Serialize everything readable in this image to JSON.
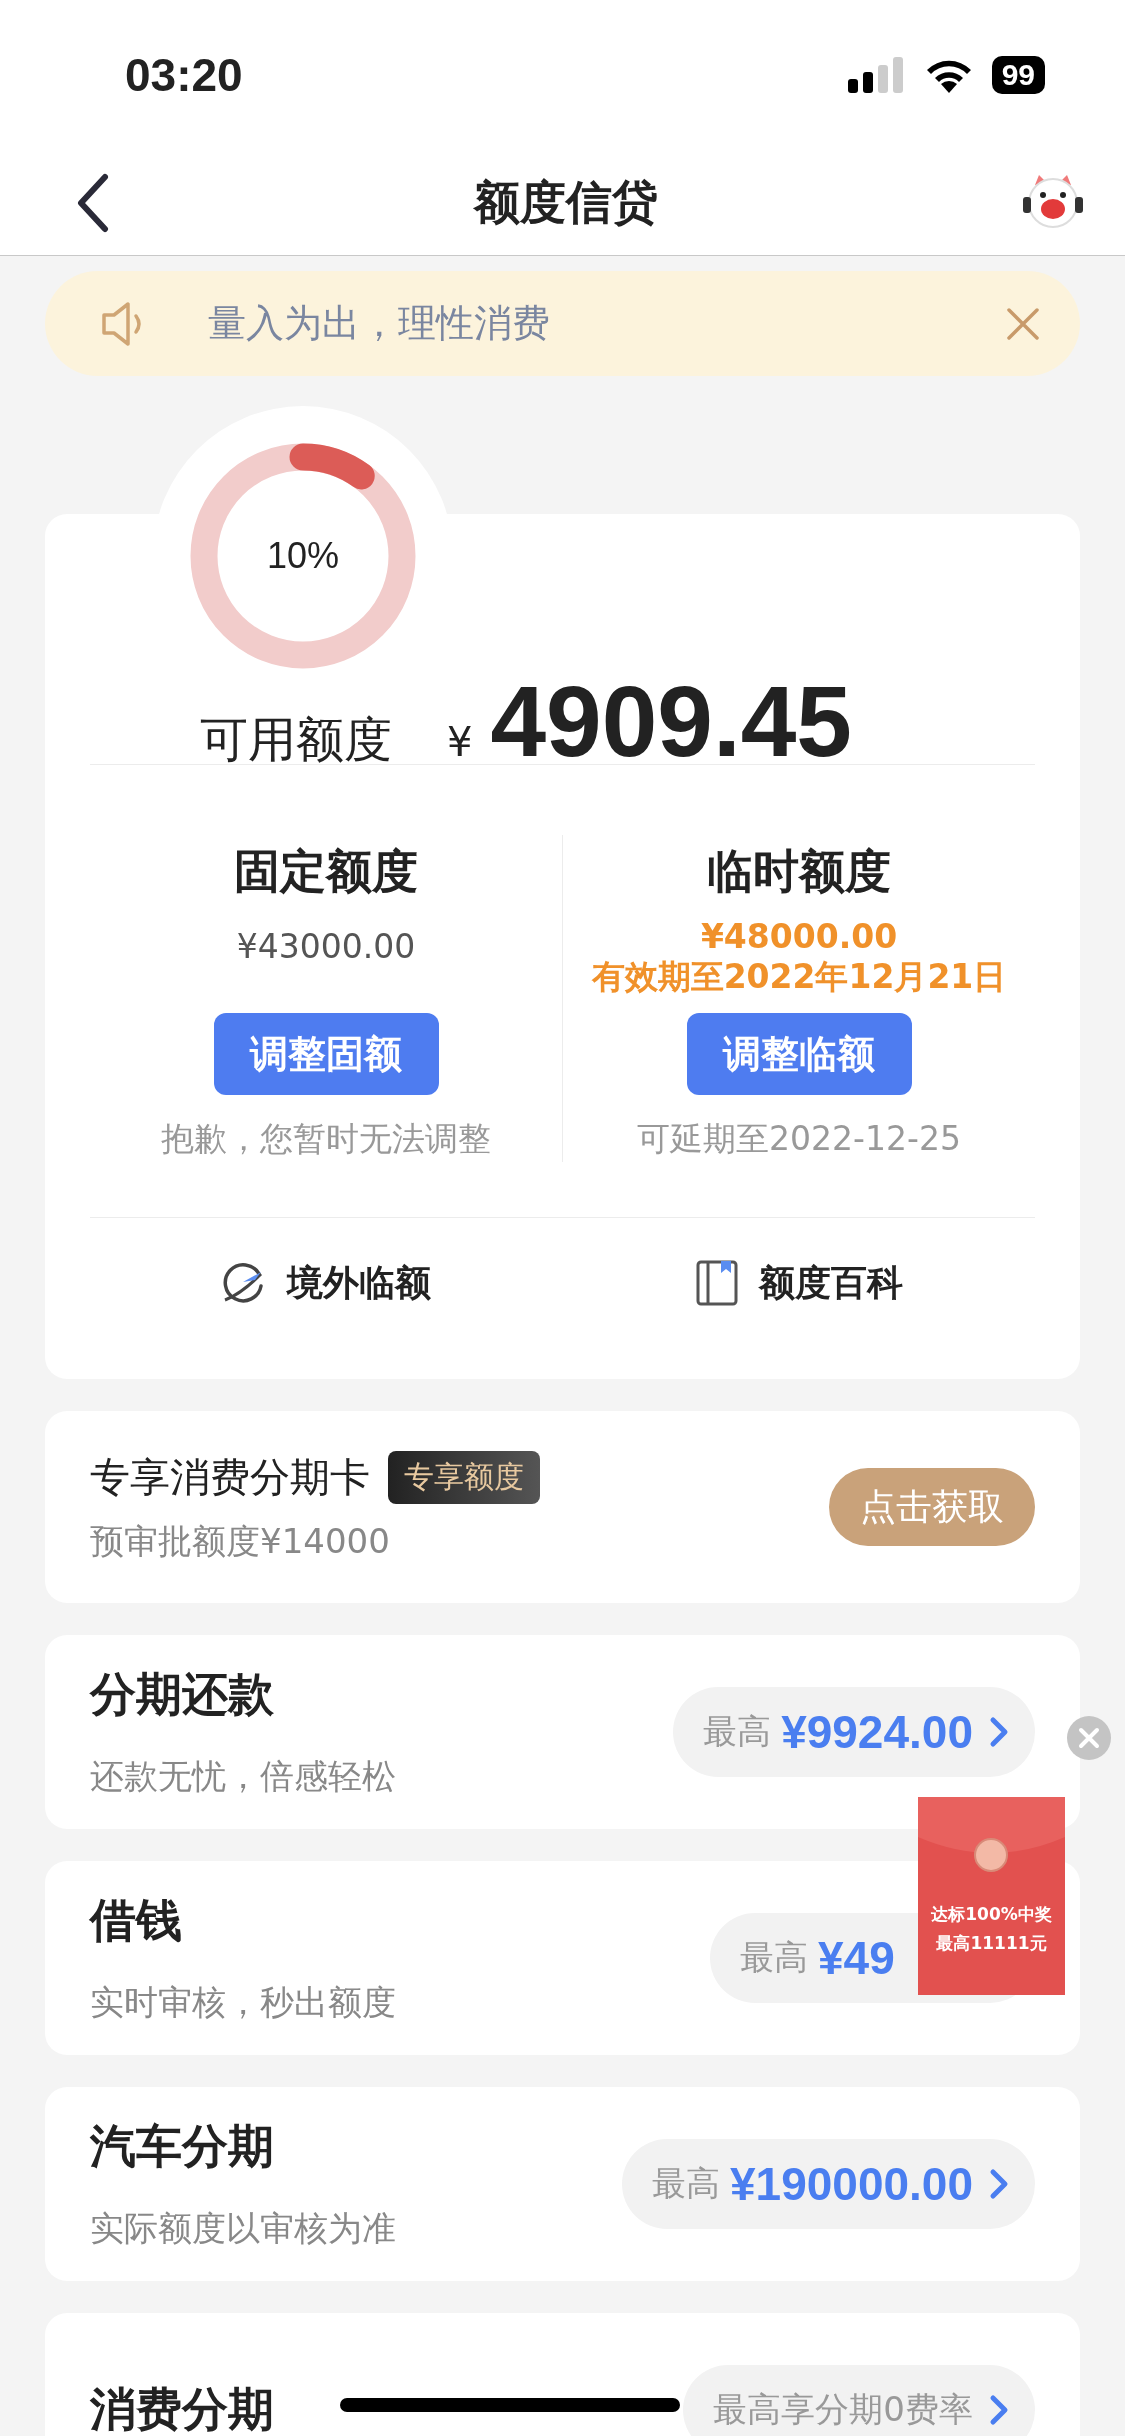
{
  "status_bar": {
    "time": "03:20",
    "battery": "99"
  },
  "nav": {
    "title": "额度信贷"
  },
  "notice": {
    "text": "量入为出，理性消费"
  },
  "credit": {
    "usage_ring": {
      "label": "10%",
      "level": 0.1
    },
    "available_label": "可用额度",
    "currency": "¥",
    "available_amount": "4909.45",
    "limits": [
      {
        "title": "固定额度",
        "lines": [
          {
            "text": "¥43000.00",
            "kind": "plain"
          }
        ],
        "button": "调整固额",
        "note": "抱歉，您暂时无法调整"
      },
      {
        "title": "临时额度",
        "lines": [
          {
            "text": "¥48000.00",
            "kind": "highlight"
          },
          {
            "text": "有效期至2022年12月21日",
            "kind": "highlight"
          }
        ],
        "button": "调整临额",
        "note": "可延期至2022-12-25"
      }
    ],
    "links": [
      {
        "label": "境外临额",
        "kind": "globe"
      },
      {
        "label": "额度百科",
        "kind": "book"
      }
    ]
  },
  "promo_card": {
    "title": "专享消费分期卡",
    "tag": "专享额度",
    "subtitle": "预审批额度¥14000",
    "button": "点击获取"
  },
  "products": [
    {
      "title": "分期还款",
      "subtitle": "还款无忧，倍感轻松",
      "prefix": "最高",
      "amount": "¥9924.00",
      "arrow": true
    },
    {
      "title": "借钱",
      "subtitle": "实时审核，秒出额度",
      "prefix": "最高",
      "amount": "¥49",
      "arrow": false
    },
    {
      "title": "汽车分期",
      "subtitle": "实际额度以审核为准",
      "prefix": "最高",
      "amount": "¥190000.00",
      "arrow": true
    },
    {
      "title": "消费分期",
      "offer": "最高享分期0费率",
      "arrow": true
    }
  ],
  "floating_ad": {
    "line1": "达标100%中奖",
    "line2": "最高11111元"
  }
}
